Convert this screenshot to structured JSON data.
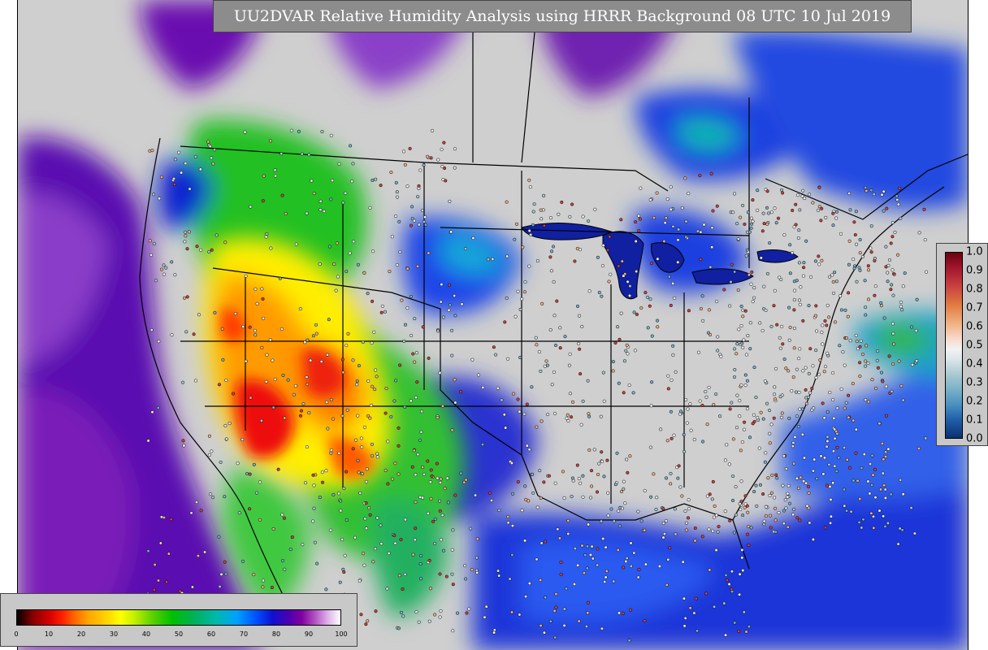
{
  "title": "UU2DVAR Relative Humidity Analysis using HRRR Background 08 UTC 10 Jul 2019",
  "colors": {
    "background_gray": "#cfcfcf",
    "ocean_blue": "#1f35d8",
    "humid_purple": "#6a00a8",
    "dry_red": "#ff2000",
    "title_box": "#8c8c8c"
  },
  "map": {
    "variable": "Relative Humidity",
    "domain": "CONUS"
  },
  "left_colorbar": {
    "ticks": [
      "0",
      "10",
      "20",
      "30",
      "40",
      "50",
      "60",
      "70",
      "80",
      "90",
      "100"
    ],
    "range": [
      0,
      100
    ]
  },
  "right_colorbar": {
    "ticks": [
      "1.0",
      "0.9",
      "0.8",
      "0.7",
      "0.6",
      "0.5",
      "0.4",
      "0.3",
      "0.2",
      "0.1",
      "0.0"
    ],
    "range": [
      0,
      1
    ]
  }
}
